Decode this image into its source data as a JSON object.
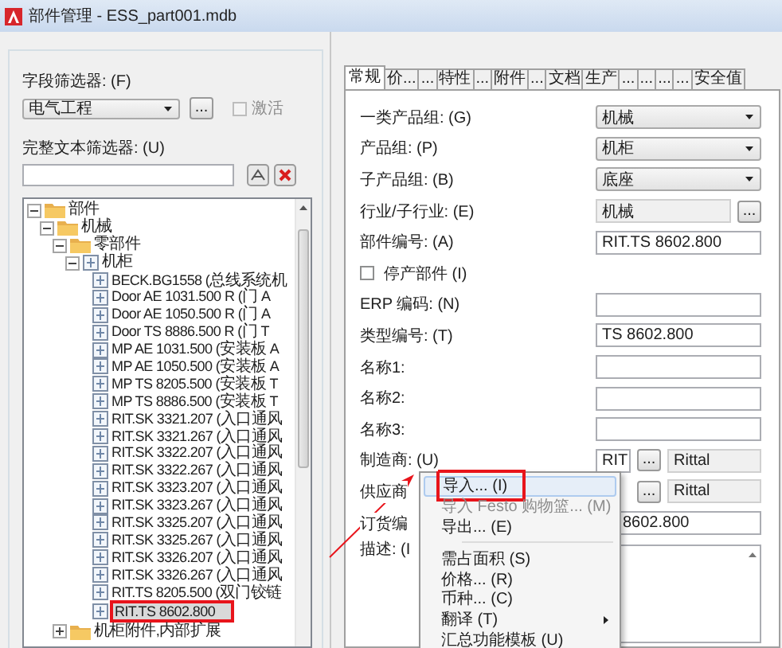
{
  "window": {
    "title": "部件管理 - ESS_part001.mdb"
  },
  "left_panel": {
    "field_filter": {
      "label": "字段筛选器: (F)",
      "value": "电气工程",
      "button": "...",
      "activate": {
        "label": "激活",
        "checked": false,
        "disabled": true
      }
    },
    "fulltext_filter": {
      "label": "完整文本筛选器: (U)"
    },
    "tree": [
      {
        "label": "部件",
        "kind": "folder",
        "expanded": true,
        "selected": false,
        "children": [
          {
            "label": "机械",
            "kind": "folder",
            "expanded": true,
            "selected": false,
            "children": [
              {
                "label": "零部件",
                "kind": "folder",
                "expanded": true,
                "selected": false,
                "children": [
                  {
                    "label": "机柜",
                    "kind": "part",
                    "expanded": true,
                    "selected": false,
                    "children": [
                      {
                        "label": "BECK.BG1558 (总线系统机",
                        "kind": "part",
                        "selected": false
                      },
                      {
                        "label": "Door AE 1031.500 R (门 A",
                        "kind": "part",
                        "selected": false
                      },
                      {
                        "label": "Door AE 1050.500 R (门 A",
                        "kind": "part",
                        "selected": false
                      },
                      {
                        "label": "Door TS 8886.500 R (门 T",
                        "kind": "part",
                        "selected": false
                      },
                      {
                        "label": "MP AE 1031.500 (安装板 A",
                        "kind": "part",
                        "selected": false
                      },
                      {
                        "label": "MP AE 1050.500 (安装板 A",
                        "kind": "part",
                        "selected": false
                      },
                      {
                        "label": "MP TS 8205.500 (安装板 T",
                        "kind": "part",
                        "selected": false
                      },
                      {
                        "label": "MP TS 8886.500 (安装板 T",
                        "kind": "part",
                        "selected": false
                      },
                      {
                        "label": "RIT.SK 3321.207 (入口通风",
                        "kind": "part",
                        "selected": false
                      },
                      {
                        "label": "RIT.SK 3321.267 (入口通风",
                        "kind": "part",
                        "selected": false
                      },
                      {
                        "label": "RIT.SK 3322.207 (入口通风",
                        "kind": "part",
                        "selected": false
                      },
                      {
                        "label": "RIT.SK 3322.267 (入口通风",
                        "kind": "part",
                        "selected": false
                      },
                      {
                        "label": "RIT.SK 3323.207 (入口通风",
                        "kind": "part",
                        "selected": false
                      },
                      {
                        "label": "RIT.SK 3323.267 (入口通风",
                        "kind": "part",
                        "selected": false
                      },
                      {
                        "label": "RIT.SK 3325.207 (入口通风",
                        "kind": "part",
                        "selected": false
                      },
                      {
                        "label": "RIT.SK 3325.267 (入口通风",
                        "kind": "part",
                        "selected": false
                      },
                      {
                        "label": "RIT.SK 3326.207 (入口通风",
                        "kind": "part",
                        "selected": false
                      },
                      {
                        "label": "RIT.SK 3326.267 (入口通风",
                        "kind": "part",
                        "selected": false
                      },
                      {
                        "label": "RIT.TS 8205.500 (双门铰链",
                        "kind": "part",
                        "selected": false
                      },
                      {
                        "label": "RIT.TS 8602.800",
                        "kind": "part",
                        "selected": true
                      }
                    ]
                  }
                ]
              },
              {
                "label": "机柜附件,内部扩展",
                "kind": "folder",
                "expanded": false,
                "selected": false
              }
            ]
          }
        ]
      }
    ]
  },
  "tabs": [
    {
      "label": "常规",
      "selected": true
    },
    {
      "label": "价...",
      "selected": false
    },
    {
      "label": "...",
      "selected": false
    },
    {
      "label": "特性",
      "selected": false
    },
    {
      "label": "...",
      "selected": false
    },
    {
      "label": "附件",
      "selected": false
    },
    {
      "label": "...",
      "selected": false
    },
    {
      "label": "文档",
      "selected": false
    },
    {
      "label": "生产",
      "selected": false
    },
    {
      "label": "...",
      "selected": false
    },
    {
      "label": "...",
      "selected": false
    },
    {
      "label": "...",
      "selected": false
    },
    {
      "label": "...",
      "selected": false
    },
    {
      "label": "安全值",
      "selected": false
    }
  ],
  "form": {
    "rows": [
      {
        "kind": "dropdown",
        "label": "一类产品组: (G)",
        "value": "机械"
      },
      {
        "kind": "dropdown",
        "label": "产品组: (P)",
        "value": "机柜"
      },
      {
        "kind": "dropdown",
        "label": "子产品组: (B)",
        "value": "底座"
      },
      {
        "kind": "browse",
        "label": "行业/子行业: (E)",
        "value": "机械",
        "button": "..."
      },
      {
        "kind": "text",
        "label": "部件编号: (A)",
        "value": "RIT.TS 8602.800"
      },
      {
        "kind": "checkbox",
        "label": "停产部件 (I)",
        "checked": false
      },
      {
        "kind": "text",
        "label": "ERP 编码: (N)"
      },
      {
        "kind": "text",
        "label": "类型编号: (T)",
        "value": "TS 8602.800"
      },
      {
        "kind": "text",
        "label": "名称1:"
      },
      {
        "kind": "text",
        "label": "名称2:"
      },
      {
        "kind": "text",
        "label": "名称3:"
      },
      {
        "kind": "dual",
        "label": "制造商: (U)",
        "value": "RIT",
        "button": "...",
        "name": "Rittal"
      },
      {
        "kind": "dual",
        "label": "供应商",
        "button": "...",
        "name": "Rittal"
      },
      {
        "kind": "covered",
        "label": "订货编",
        "value": "8602.800"
      },
      {
        "kind": "memo",
        "label": "描述: (I"
      }
    ]
  },
  "context_menu": {
    "items": [
      {
        "kind": "item",
        "label": "导入... (I)",
        "disabled": false,
        "selected": true
      },
      {
        "kind": "item",
        "label": "导入 Festo 购物篮... (M)",
        "disabled": true,
        "selected": false
      },
      {
        "kind": "item",
        "label": "导出... (E)",
        "disabled": false,
        "selected": false
      },
      {
        "kind": "separator"
      },
      {
        "kind": "item",
        "label": "需占面积 (S)",
        "disabled": false,
        "selected": false
      },
      {
        "kind": "item",
        "label": "价格... (R)",
        "disabled": false,
        "selected": false
      },
      {
        "kind": "item",
        "label": "币种... (C)",
        "disabled": false,
        "selected": false
      },
      {
        "kind": "submenu",
        "label": "翻译 (T)",
        "disabled": false,
        "selected": false
      },
      {
        "kind": "item",
        "label": "汇总功能模板 (U)",
        "disabled": false,
        "selected": false
      }
    ]
  }
}
